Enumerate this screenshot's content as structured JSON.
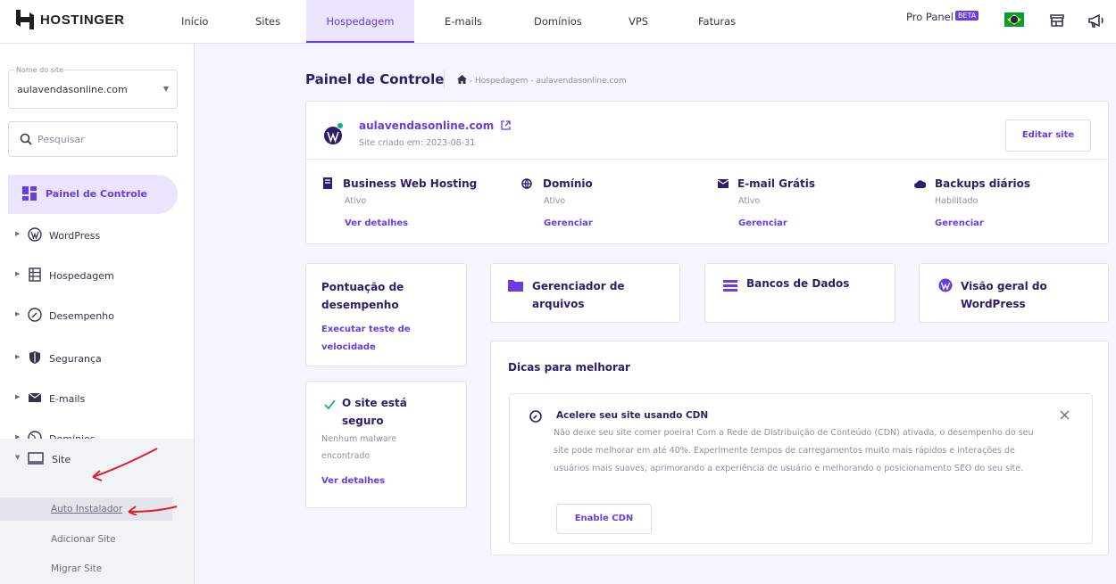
{
  "brand": {
    "logo_text": "HOSTINGER"
  },
  "topnav": {
    "items": [
      {
        "label": "Início"
      },
      {
        "label": "Sites"
      },
      {
        "label": "Hospedagem"
      },
      {
        "label": "E-mails"
      },
      {
        "label": "Domínios"
      },
      {
        "label": "VPS"
      },
      {
        "label": "Faturas"
      }
    ],
    "active_index": 2,
    "pro_panel": "Pro Panel",
    "beta": "BETA"
  },
  "sidebar": {
    "site_select_label": "Nome do site",
    "site_select_value": "aulavendasonline.com",
    "search_placeholder": "Pesquisar",
    "active_label": "Painel de Controle",
    "items": [
      {
        "label": "WordPress",
        "icon": "wordpress-icon"
      },
      {
        "label": "Hospedagem",
        "icon": "server-icon"
      },
      {
        "label": "Desempenho",
        "icon": "gauge-icon"
      },
      {
        "label": "Segurança",
        "icon": "shield-icon"
      },
      {
        "label": "E-mails",
        "icon": "mail-icon"
      },
      {
        "label": "Domínios",
        "icon": "globe-icon"
      },
      {
        "label": "Site",
        "icon": "monitor-icon"
      }
    ],
    "sub_items": [
      {
        "label": "Auto Instalador"
      },
      {
        "label": "Adicionar Site"
      },
      {
        "label": "Migrar Site"
      }
    ]
  },
  "page": {
    "title": "Painel de Controle",
    "breadcrumb": "- Hospedagem - aulavendasonline.com"
  },
  "site_card": {
    "domain": "aulavendasonline.com",
    "created": "Site criado em: 2023-08-31",
    "edit_button": "Editar site",
    "features": [
      {
        "title": "Business Web Hosting",
        "status": "Ativo",
        "action": "Ver detalhes"
      },
      {
        "title": "Domínio",
        "status": "Ativo",
        "action": "Gerenciar"
      },
      {
        "title": "E-mail Grátis",
        "status": "Ativo",
        "action": "Gerenciar"
      },
      {
        "title": "Backups diários",
        "status": "Habilitado",
        "action": "Gerenciar"
      }
    ]
  },
  "performance_card": {
    "title": "Pontuação de desempenho",
    "action": "Executar teste de velocidade"
  },
  "security_card": {
    "title": "O site está seguro",
    "text": "Nenhum malware encontrado",
    "action": "Ver detalhes"
  },
  "quick_cards": [
    {
      "label": "Gerenciador de arquivos"
    },
    {
      "label": "Bancos de Dados"
    },
    {
      "label": "Visão geral do WordPress"
    }
  ],
  "tips": {
    "heading": "Dicas para melhorar",
    "tip_title": "Acelere seu site usando CDN",
    "tip_text": "Não deixe seu site comer poeira! Com a Rede de Distribuição de Conteúdo (CDN) ativada, o desempenho do seu site pode melhorar em até 40%. Experimente tempos de carregamentos muito mais rápidos e interações de usuários mais suaves, aprimorando a experiência de usuário e melhorando o posicionamento SEO do seu site.",
    "button": "Enable CDN"
  },
  "colors": {
    "accent": "#673de6",
    "accent_bg": "#ebe4ff",
    "dark_text": "#2f1c6a",
    "success": "#00b090",
    "annotation": "#e0202a"
  }
}
